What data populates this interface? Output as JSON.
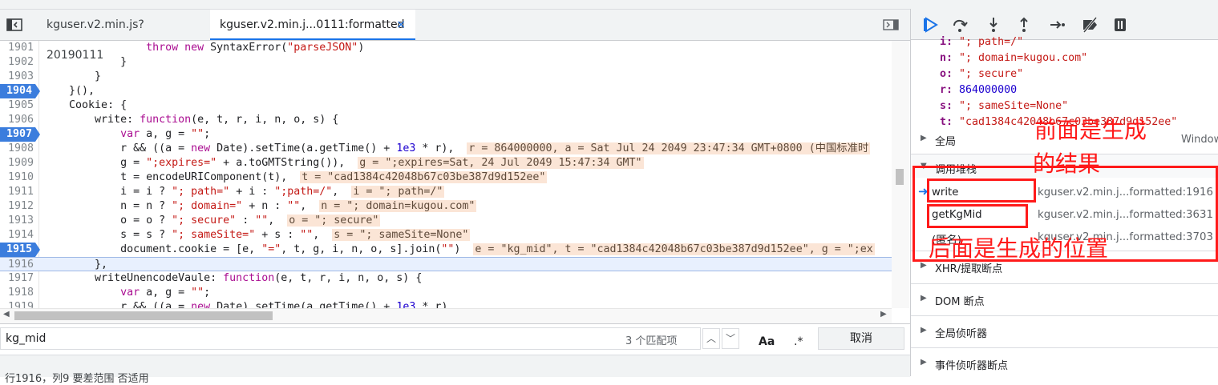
{
  "tabs": [
    {
      "label": "kguser.v2.min.js?20190111"
    },
    {
      "label": "kguser.v2.min.j...0111:formatted",
      "close": "×"
    }
  ],
  "code_lines": [
    {
      "n": "1901",
      "indent": "                ",
      "parts": [
        [
          "kw",
          "throw "
        ],
        [
          "kw",
          "new "
        ],
        [
          "prop",
          "SyntaxError("
        ],
        [
          "str",
          "\"parseJSON\""
        ],
        [
          "prop",
          ")"
        ]
      ]
    },
    {
      "n": "1902",
      "indent": "            ",
      "parts": [
        [
          "prop",
          "}"
        ]
      ]
    },
    {
      "n": "1903",
      "indent": "        ",
      "parts": [
        [
          "prop",
          "}"
        ]
      ]
    },
    {
      "n": "1904",
      "indent": "    ",
      "parts": [
        [
          "prop",
          "}(),"
        ]
      ],
      "bp": true
    },
    {
      "n": "1905",
      "indent": "    ",
      "parts": [
        [
          "prop",
          "Cookie: {"
        ]
      ]
    },
    {
      "n": "1906",
      "indent": "        ",
      "parts": [
        [
          "prop",
          "write: "
        ],
        [
          "kw",
          "function"
        ],
        [
          "prop",
          "(e, t, r, i, n, o, s) {"
        ]
      ]
    },
    {
      "n": "1907",
      "indent": "            ",
      "parts": [
        [
          "kw",
          "var "
        ],
        [
          "prop",
          "a, g = "
        ],
        [
          "str",
          "\"\""
        ],
        [
          "prop",
          ";"
        ]
      ],
      "bp": true
    },
    {
      "n": "1908",
      "indent": "            ",
      "parts": [
        [
          "prop",
          "r && ((a = "
        ],
        [
          "kw",
          "new "
        ],
        [
          "prop",
          "Date).setTime(a.getTime() + "
        ],
        [
          "num",
          "1e3"
        ],
        [
          "prop",
          " * r),  "
        ],
        [
          "inl",
          "r = 864000000, a = Sat Jul 24 2049 23:47:34 GMT+0800 (中国标准时"
        ]
      ]
    },
    {
      "n": "1909",
      "indent": "            ",
      "parts": [
        [
          "prop",
          "g = "
        ],
        [
          "str",
          "\";expires=\""
        ],
        [
          "prop",
          " + a.toGMTString()),  "
        ],
        [
          "inl",
          "g = \";expires=Sat, 24 Jul 2049 15:47:34 GMT\""
        ]
      ]
    },
    {
      "n": "1910",
      "indent": "            ",
      "parts": [
        [
          "prop",
          "t = encodeURIComponent(t),  "
        ],
        [
          "inl",
          "t = \"cad1384c42048b67c03be387d9d152ee\""
        ]
      ]
    },
    {
      "n": "1911",
      "indent": "            ",
      "parts": [
        [
          "prop",
          "i = i ? "
        ],
        [
          "str",
          "\"; path=\""
        ],
        [
          "prop",
          " + i : "
        ],
        [
          "str",
          "\";path=/\""
        ],
        [
          "prop",
          ",  "
        ],
        [
          "inl",
          "i = \"; path=/\""
        ]
      ]
    },
    {
      "n": "1912",
      "indent": "            ",
      "parts": [
        [
          "prop",
          "n = n ? "
        ],
        [
          "str",
          "\"; domain=\""
        ],
        [
          "prop",
          " + n : "
        ],
        [
          "str",
          "\"\""
        ],
        [
          "prop",
          ",  "
        ],
        [
          "inl",
          "n = \"; domain=kugou.com\""
        ]
      ]
    },
    {
      "n": "1913",
      "indent": "            ",
      "parts": [
        [
          "prop",
          "o = o ? "
        ],
        [
          "str",
          "\"; secure\""
        ],
        [
          "prop",
          " : "
        ],
        [
          "str",
          "\"\""
        ],
        [
          "prop",
          ",  "
        ],
        [
          "inl",
          "o = \"; secure\""
        ]
      ]
    },
    {
      "n": "1914",
      "indent": "            ",
      "parts": [
        [
          "prop",
          "s = s ? "
        ],
        [
          "str",
          "\"; sameSite=\""
        ],
        [
          "prop",
          " + s : "
        ],
        [
          "str",
          "\"\""
        ],
        [
          "prop",
          ",  "
        ],
        [
          "inl",
          "s = \"; sameSite=None\""
        ]
      ]
    },
    {
      "n": "1915",
      "indent": "            ",
      "parts": [
        [
          "prop",
          "document.cookie = [e, "
        ],
        [
          "str",
          "\"=\""
        ],
        [
          "prop",
          ", t, g, i, n, o, s].join("
        ],
        [
          "str",
          "\"\""
        ],
        [
          "prop",
          ")  "
        ],
        [
          "inl",
          "e = \"kg_mid\", t = \"cad1384c42048b67c03be387d9d152ee\", g = \";ex"
        ]
      ],
      "bp": true
    },
    {
      "n": "1916",
      "indent": "        ",
      "parts": [
        [
          "prop",
          "},"
        ]
      ],
      "hl": true
    },
    {
      "n": "1917",
      "indent": "        ",
      "parts": [
        [
          "prop",
          "writeUnencodeVaule: "
        ],
        [
          "kw",
          "function"
        ],
        [
          "prop",
          "(e, t, r, i, n, o, s) {"
        ]
      ]
    },
    {
      "n": "1918",
      "indent": "            ",
      "parts": [
        [
          "kw",
          "var "
        ],
        [
          "prop",
          "a, g = "
        ],
        [
          "str",
          "\"\""
        ],
        [
          "prop",
          ";"
        ]
      ]
    },
    {
      "n": "1919",
      "indent": "            ",
      "parts": [
        [
          "prop",
          "r && ((a = "
        ],
        [
          "kw",
          "new "
        ],
        [
          "prop",
          "Date).setTime(a.getTime() + "
        ],
        [
          "num",
          "1e3"
        ],
        [
          "prop",
          " * r)"
        ]
      ]
    }
  ],
  "search": {
    "value": "kg_mid",
    "match_count": "3 个匹配项",
    "case_label": "Aa",
    "regex_label": ".*",
    "cancel": "取消"
  },
  "status": "行1916，列9 要差范围 否适用",
  "scope": [
    {
      "k": "i:",
      "v": "\"; path=/\"",
      "type": "str"
    },
    {
      "k": "n:",
      "v": "\"; domain=kugou.com\"",
      "type": "str"
    },
    {
      "k": "o:",
      "v": "\"; secure\"",
      "type": "str"
    },
    {
      "k": "r:",
      "v": "864000000",
      "type": "num"
    },
    {
      "k": "s:",
      "v": "\"; sameSite=None\"",
      "type": "str"
    },
    {
      "k": "t:",
      "v": "\"cad1384c42048b67c03be387d9d152ee\"",
      "type": "str"
    }
  ],
  "global": {
    "label": "全局",
    "value": "Window"
  },
  "callstack": {
    "title": "调用堆栈",
    "frames": [
      {
        "fn": "write",
        "loc": "kguser.v2.min.j...formatted:1916",
        "current": true
      },
      {
        "fn": "getKgMid",
        "loc": "kguser.v2.min.j...formatted:3631"
      },
      {
        "fn": "(匿名)",
        "loc": "kguser.v2.min.j...formatted:3703"
      }
    ]
  },
  "sections": [
    "XHR/提取断点",
    "DOM 断点",
    "全局侦听器",
    "事件侦听器断点"
  ],
  "annotations": {
    "top": [
      "前面是生成",
      "的结果"
    ],
    "bottom": "后面是生成的位置"
  },
  "colors": {
    "accent": "#1a73e8",
    "breakpoint": "#3b7ddd",
    "annotation": "#ff1a1a"
  }
}
